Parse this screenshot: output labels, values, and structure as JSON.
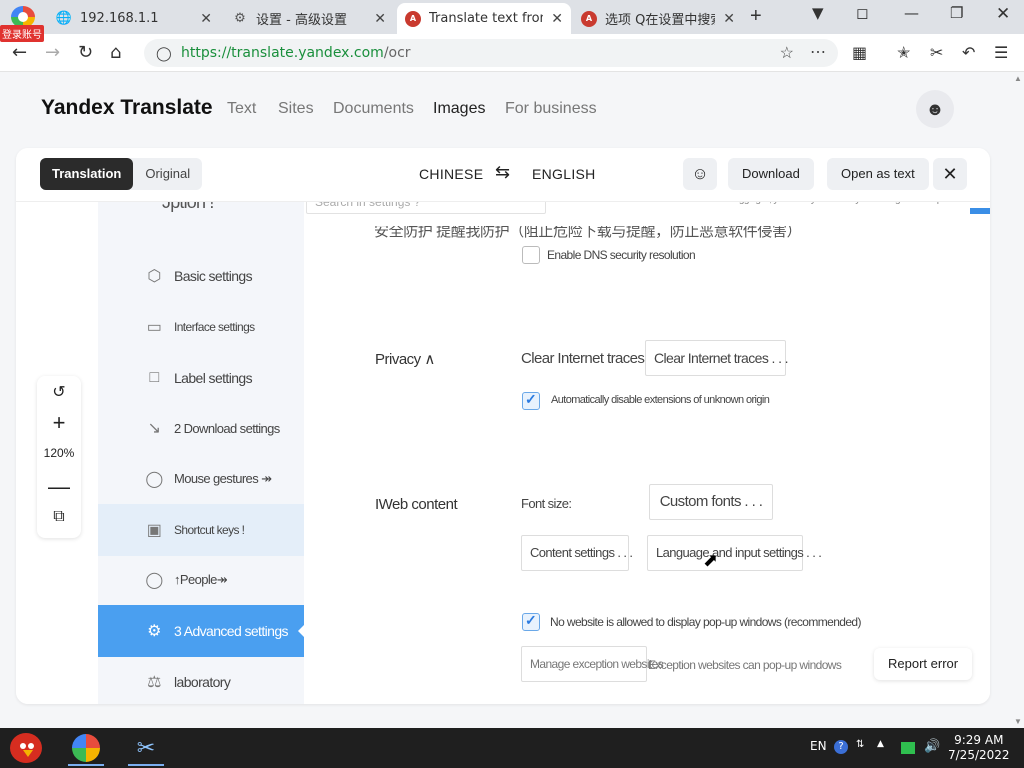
{
  "browser": {
    "login_label": "登录账号",
    "tabs": [
      {
        "title": "192.168.1.1",
        "icon": "globe-icon"
      },
      {
        "title": "设置 - 高级设置",
        "icon": "gear-icon"
      },
      {
        "title": "Translate text from pl",
        "icon": "yandex-translate-favicon",
        "active": true
      },
      {
        "title": "选项 Q在设置中搜索",
        "icon": "yandex-translate-favicon"
      }
    ],
    "url_base": "https://translate.yandex.com",
    "url_path": "/ocr"
  },
  "yandex": {
    "logo": "Yandex Translate",
    "nav": [
      {
        "label": "Text"
      },
      {
        "label": "Sites"
      },
      {
        "label": "Documents"
      },
      {
        "label": "Images",
        "active": true
      },
      {
        "label": "For business"
      }
    ],
    "toolbar": {
      "translation_label": "Translation",
      "original_label": "Original",
      "source_lang": "CHINESE",
      "target_lang": "ENGLISH",
      "download_label": "Download",
      "open_as_text_label": "Open as text"
    },
    "zoom_level": "120%",
    "report_label": "Report error"
  },
  "doc": {
    "top_option": "Jption !",
    "search_placeholder": "Search in settings ?",
    "login_note": "After logging in, you can synchronize your settings on multiple channels",
    "sidebar": [
      {
        "label": "Basic settings",
        "icon": "hexagon-icon"
      },
      {
        "label": "Interface settings",
        "icon": "window-icon"
      },
      {
        "label": "Label settings",
        "icon": "label-icon"
      },
      {
        "label": "2 Download settings",
        "icon": "download-icon"
      },
      {
        "label": "Mouse gestures ↠",
        "icon": "mouse-icon"
      },
      {
        "label": "Shortcut keys !",
        "icon": "keyboard-icon",
        "state": "hover"
      },
      {
        "label": "↑People↠",
        "icon": "person-icon"
      },
      {
        "label": "3 Advanced settings",
        "icon": "settings-icon",
        "state": "active"
      },
      {
        "label": "laboratory",
        "icon": "flask-icon"
      }
    ],
    "top_cut_text": "安全防护  提醒我防护（阻止危险下载与提醒，防止恶意软件侵害）",
    "dns_option": "Enable DNS security resolution",
    "privacy_label": "Privacy ∧",
    "clear_traces_label": "Clear Internet traces:",
    "clear_traces_button": "Clear Internet traces . . .",
    "auto_disable_ext": "Automatically disable extensions of unknown origin",
    "web_content_label": "IWeb content",
    "font_size_label": "Font size:",
    "custom_fonts_button": "Custom fonts . . .",
    "content_settings_button": "Content settings . . .",
    "language_settings_button": "Language and input settings . . .",
    "popup_option": "No website is allowed to display pop-up windows (recommended)",
    "manage_exceptions_button": "Manage exception websites",
    "exception_note": "Exception websites can pop-up windows"
  },
  "taskbar": {
    "lang": "EN",
    "time": "9:29 AM",
    "date": "7/25/2022"
  }
}
